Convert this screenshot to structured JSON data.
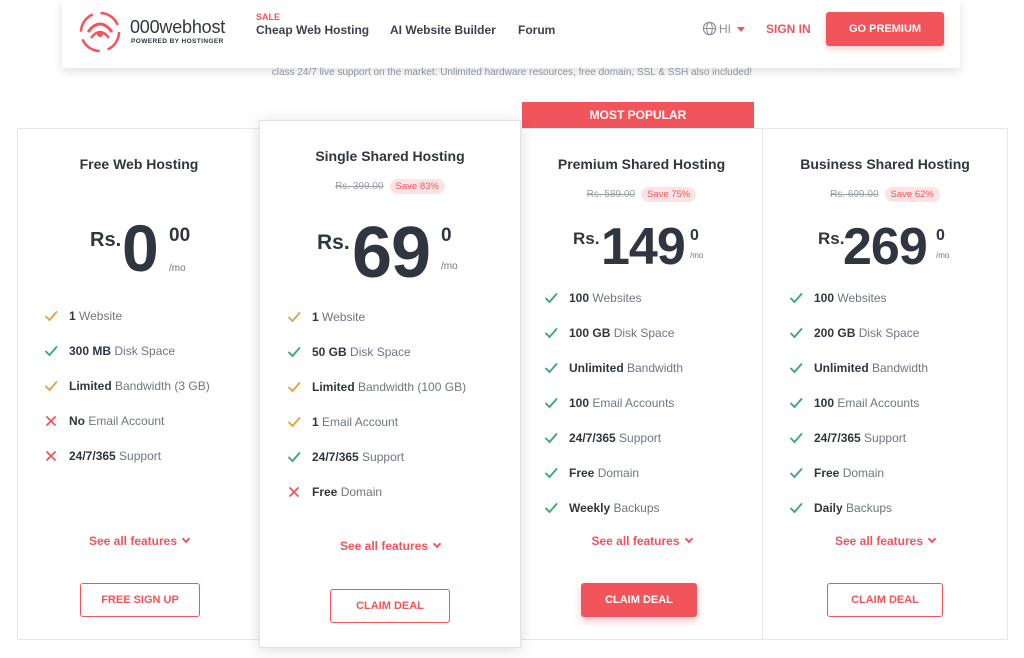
{
  "header": {
    "logo_name": "000webhost",
    "logo_sub": "POWERED BY HOSTINGER",
    "nav": [
      {
        "badge": "SALE",
        "label": "Cheap Web Hosting"
      },
      {
        "label": "AI Website Builder"
      },
      {
        "label": "Forum"
      }
    ],
    "language": "HI",
    "sign_in": "SIGN IN",
    "go_premium": "GO PREMIUM"
  },
  "subtext": "class 24/7 live support on the market. Unlimited hardware resources, free domain, SSL & SSH also included!",
  "popular_label": "MOST POPULAR",
  "colors": {
    "accent": "#f2545b",
    "check_green": "#3aa676",
    "check_yellow": "#e6a23c",
    "cross_red": "#f2545b"
  },
  "plans": [
    {
      "title": "Free Web Hosting",
      "currency": "Rs.",
      "amount": "0",
      "cents": "00",
      "per": "/mo",
      "features": [
        {
          "icon": "check-yellow",
          "bold": "1",
          "text": " Website"
        },
        {
          "icon": "check-green",
          "bold": "300 MB",
          "text": " Disk Space"
        },
        {
          "icon": "check-yellow",
          "bold": "Limited",
          "text": " Bandwidth (3 GB)"
        },
        {
          "icon": "cross-red",
          "bold": "No",
          "text": " Email Account"
        },
        {
          "icon": "cross-red",
          "bold": "24/7/365",
          "text": " Support"
        }
      ],
      "see_all": "See all features",
      "cta": "FREE SIGN UP"
    },
    {
      "title": "Single Shared Hosting",
      "old_price": "Rs. 399.00",
      "save": "Save 83%",
      "currency": "Rs.",
      "amount": "69",
      "cents": "0",
      "per": "/mo",
      "features": [
        {
          "icon": "check-yellow",
          "bold": "1",
          "text": " Website"
        },
        {
          "icon": "check-green",
          "bold": "50 GB",
          "text": " Disk Space"
        },
        {
          "icon": "check-yellow",
          "bold": "Limited",
          "text": " Bandwidth (100 GB)"
        },
        {
          "icon": "check-yellow",
          "bold": "1",
          "text": " Email Account"
        },
        {
          "icon": "check-green",
          "bold": "24/7/365",
          "text": " Support"
        },
        {
          "icon": "cross-red",
          "bold": "Free",
          "text": " Domain"
        }
      ],
      "see_all": "See all features",
      "cta": "CLAIM DEAL"
    },
    {
      "title": "Premium Shared Hosting",
      "old_price": "Rs. 589.00",
      "save": "Save 75%",
      "currency": "Rs.",
      "amount": "149",
      "cents": "0",
      "per": "/mo",
      "features": [
        {
          "icon": "check-green",
          "bold": "100",
          "text": " Websites"
        },
        {
          "icon": "check-green",
          "bold": "100 GB",
          "text": " Disk Space"
        },
        {
          "icon": "check-green",
          "bold": "Unlimited",
          "text": " Bandwidth"
        },
        {
          "icon": "check-green",
          "bold": "100",
          "text": " Email Accounts"
        },
        {
          "icon": "check-green",
          "bold": "24/7/365",
          "text": " Support"
        },
        {
          "icon": "check-green",
          "bold": "Free",
          "text": " Domain"
        },
        {
          "icon": "check-green",
          "bold": "Weekly",
          "text": " Backups"
        }
      ],
      "see_all": "See all features",
      "cta": "CLAIM DEAL"
    },
    {
      "title": "Business Shared Hosting",
      "old_price": "Rs. 699.00",
      "save": "Save 62%",
      "currency": "Rs.",
      "amount": "269",
      "cents": "0",
      "per": "/mo",
      "features": [
        {
          "icon": "check-green",
          "bold": "100",
          "text": " Websites"
        },
        {
          "icon": "check-green",
          "bold": "200 GB",
          "text": " Disk Space"
        },
        {
          "icon": "check-green",
          "bold": "Unlimited",
          "text": " Bandwidth"
        },
        {
          "icon": "check-green",
          "bold": "100",
          "text": " Email Accounts"
        },
        {
          "icon": "check-green",
          "bold": "24/7/365",
          "text": " Support"
        },
        {
          "icon": "check-green",
          "bold": "Free",
          "text": " Domain"
        },
        {
          "icon": "check-green",
          "bold": "Daily",
          "text": " Backups"
        }
      ],
      "see_all": "See all features",
      "cta": "CLAIM DEAL"
    }
  ]
}
